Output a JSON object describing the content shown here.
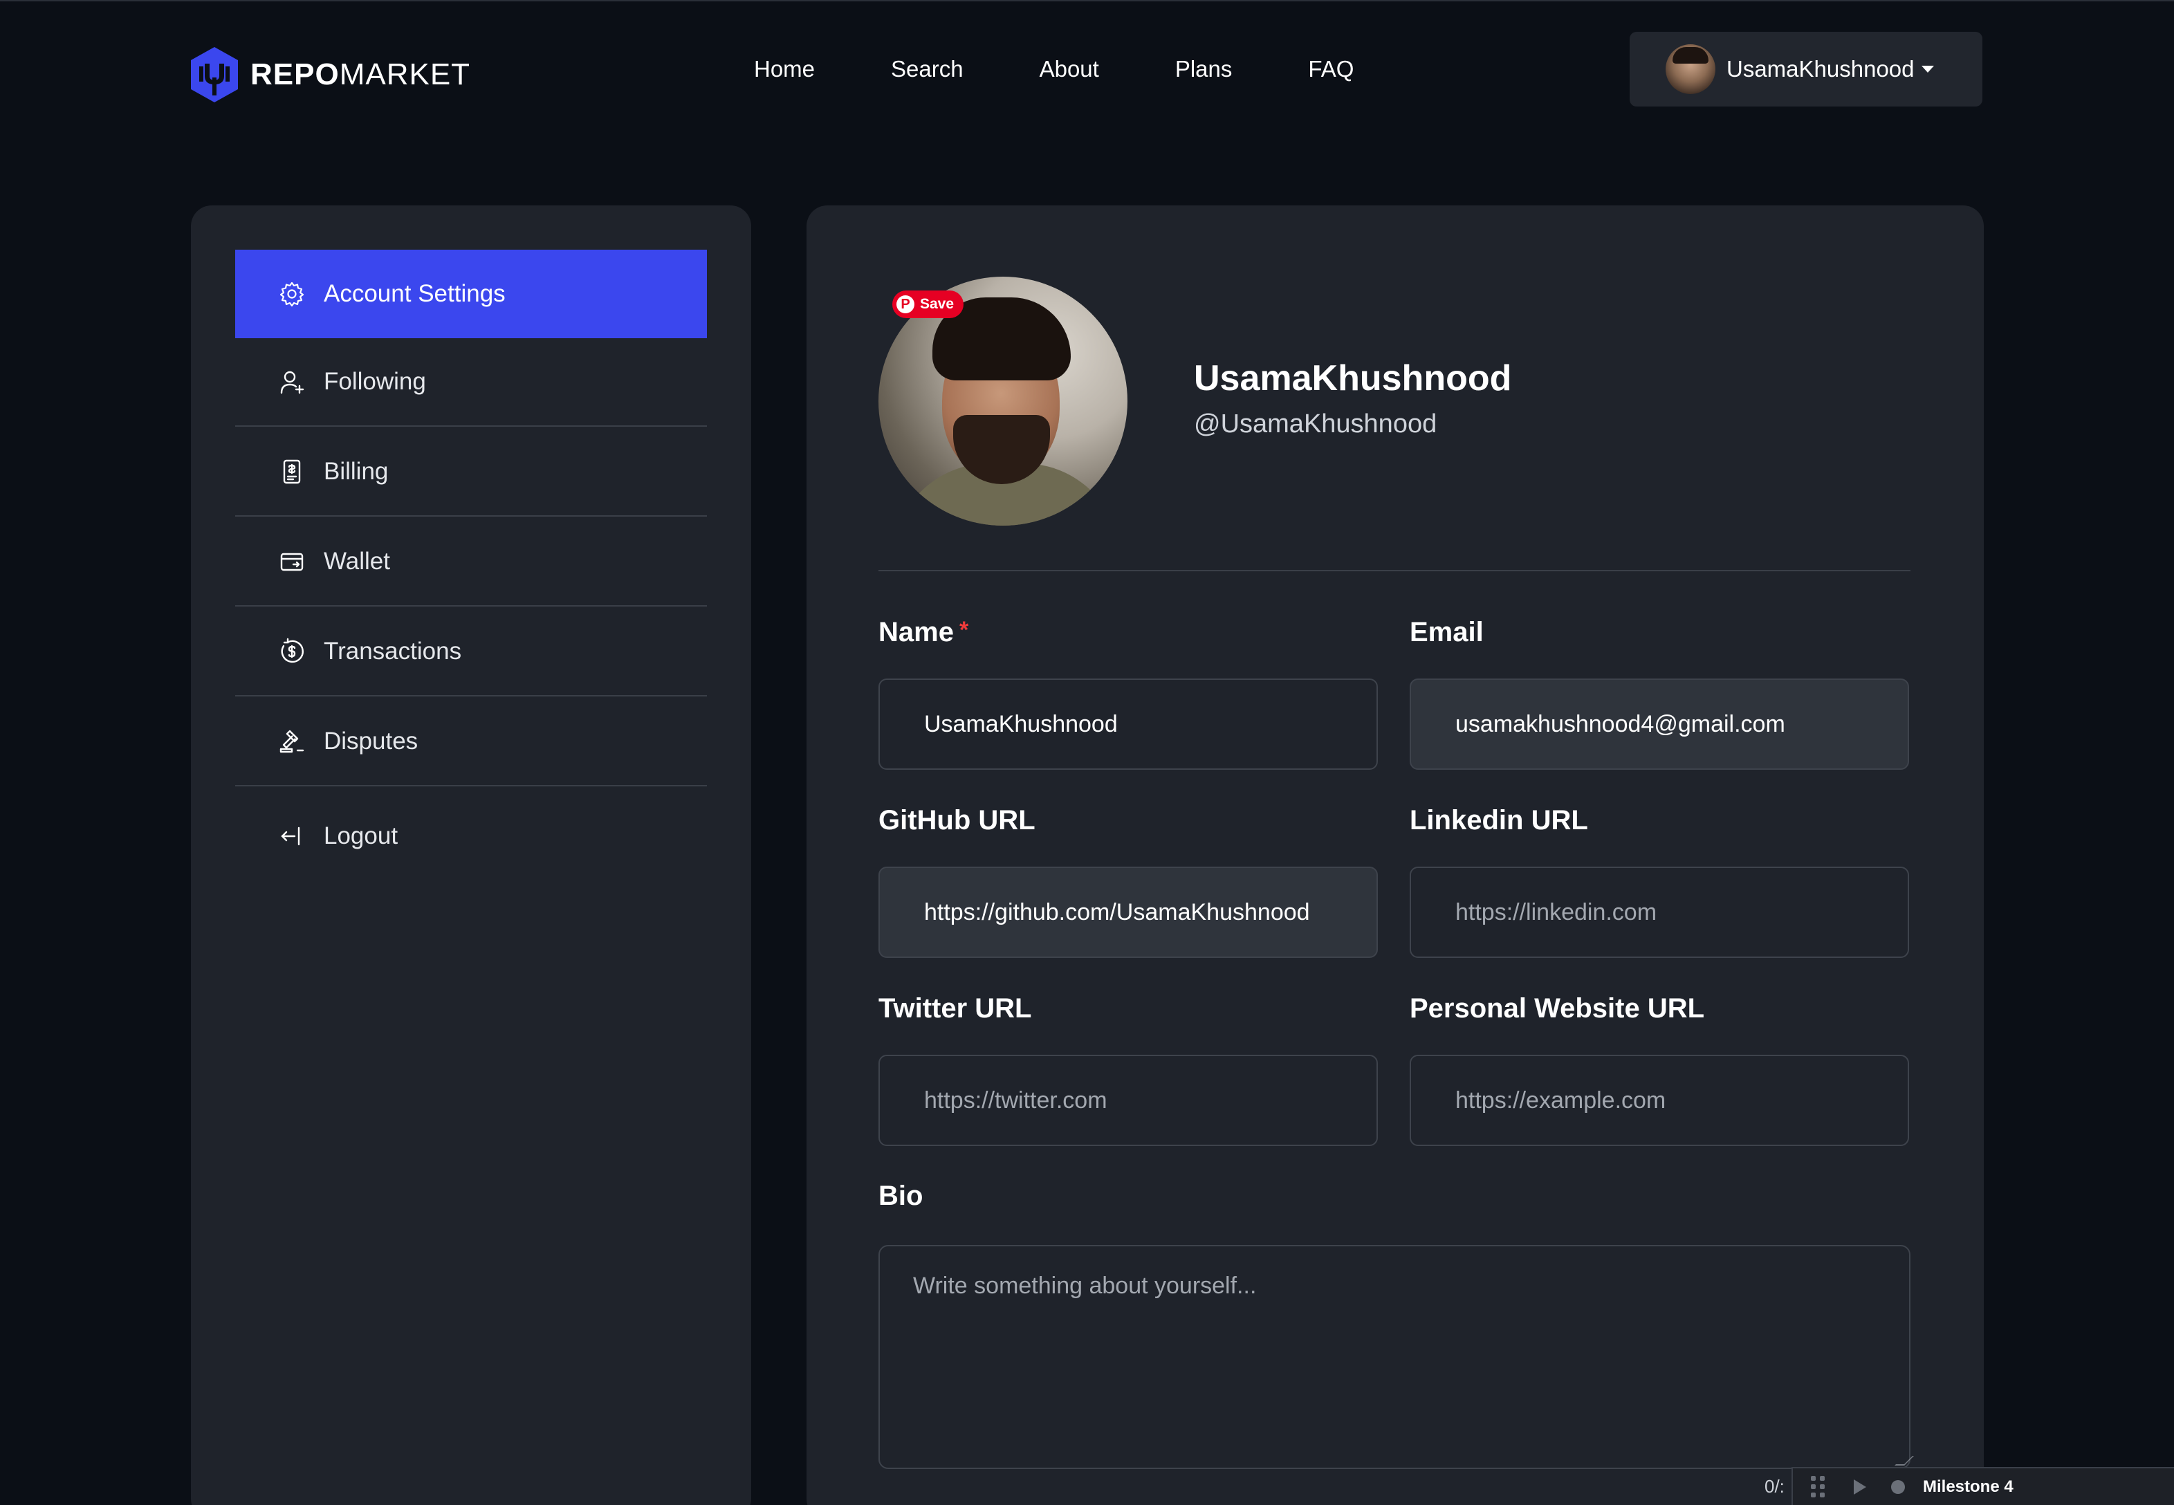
{
  "brand": {
    "bold": "REPO",
    "light": "MARKET",
    "color": "#3b47ee"
  },
  "nav": {
    "links": [
      "Home",
      "Search",
      "About",
      "Plans",
      "FAQ"
    ]
  },
  "user_menu": {
    "name": "UsamaKhushnood",
    "icon": "chevron-down-icon"
  },
  "sidebar": {
    "items": [
      {
        "label": "Account Settings",
        "icon": "gear-icon",
        "active": true
      },
      {
        "label": "Following",
        "icon": "user-plus-icon"
      },
      {
        "label": "Billing",
        "icon": "receipt-icon"
      },
      {
        "label": "Wallet",
        "icon": "wallet-icon"
      },
      {
        "label": "Transactions",
        "icon": "dollar-cycle-icon"
      },
      {
        "label": "Disputes",
        "icon": "gavel-icon"
      },
      {
        "label": "Logout",
        "icon": "logout-icon"
      }
    ]
  },
  "profile": {
    "name": "UsamaKhushnood",
    "handle": "@UsamaKhushnood",
    "save_badge": "Save"
  },
  "form": {
    "name": {
      "label": "Name",
      "required_mark": "*",
      "value": "UsamaKhushnood"
    },
    "email": {
      "label": "Email",
      "value": "usamakhushnood4@gmail.com"
    },
    "github": {
      "label": "GitHub URL",
      "value": "https://github.com/UsamaKhushnood"
    },
    "linkedin": {
      "label": "Linkedin URL",
      "placeholder": "https://linkedin.com"
    },
    "twitter": {
      "label": "Twitter URL",
      "placeholder": "https://twitter.com"
    },
    "website": {
      "label": "Personal Website URL",
      "placeholder": "https://example.com"
    },
    "bio": {
      "label": "Bio",
      "placeholder": "Write something about yourself..."
    },
    "bio_counter": "0/:"
  },
  "toolbar": {
    "label": "Milestone 4"
  }
}
